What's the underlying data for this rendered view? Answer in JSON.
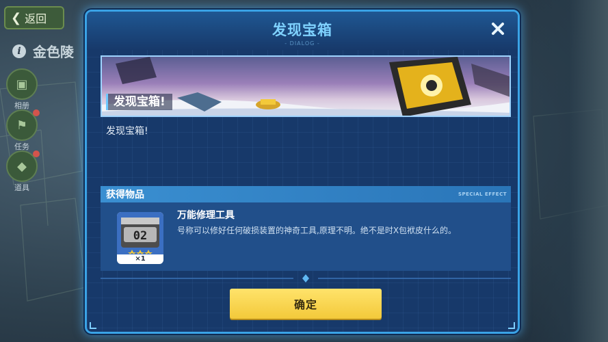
{
  "background": {
    "back_label": "返回",
    "back_icon": "chevron-left-icon",
    "title": "金色陵",
    "info_icon_glyph": "i",
    "sidebar": [
      {
        "label": "相册",
        "icon": "album-icon",
        "badge": false
      },
      {
        "label": "任务",
        "icon": "task-icon",
        "badge": true
      },
      {
        "label": "道具",
        "icon": "box-icon",
        "badge": true
      }
    ]
  },
  "dialog": {
    "title": "发现宝箱",
    "subtitle": "- DIALOG -",
    "close_icon": "close-icon",
    "banner_label": "发现宝箱!",
    "body_text": "发现宝箱!",
    "items_section": {
      "title": "获得物品",
      "tag": "SPECIAL EFFECT",
      "items": [
        {
          "name": "万能修理工具",
          "description": "号称可以修好任何破损装置的神奇工具,原理不明。绝不是时X包袱皮什么的。",
          "count": "×1",
          "icon": "repair-toolbox-icon",
          "badge_text": "02",
          "stars": 3
        }
      ]
    },
    "confirm_label": "确定"
  },
  "colors": {
    "dialog_bg": "#17396a",
    "dialog_border": "#3aa3e6",
    "title_color": "#7fd2ff",
    "confirm_bg": "#f3c93a",
    "section_header": "#3a8fd1"
  }
}
